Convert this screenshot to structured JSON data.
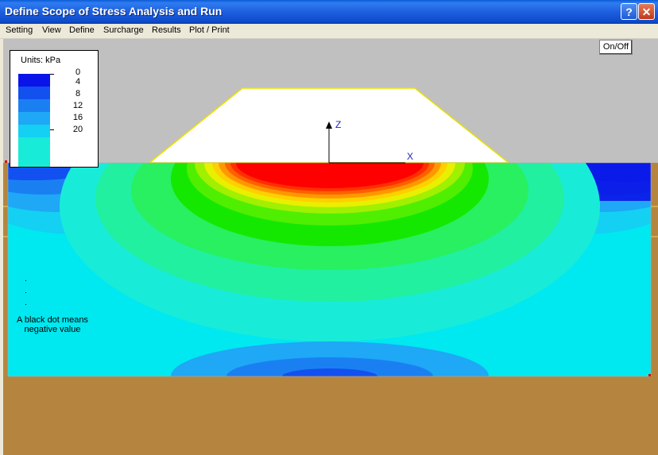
{
  "window": {
    "title": "Define Scope of Stress Analysis and Run",
    "help_glyph": "?",
    "close_glyph": "✕"
  },
  "menu": {
    "items": [
      "Setting",
      "View",
      "Define",
      "Surcharge",
      "Results",
      "Plot / Print"
    ]
  },
  "toolbar": {
    "onoff_label": "On/Off"
  },
  "legend": {
    "title": "Units:  kPa",
    "labels": [
      "0",
      "4",
      "8",
      "12",
      "16",
      "20"
    ],
    "colors": [
      "#0a14e8",
      "#1250f0",
      "#1a80f2",
      "#1ea8f6",
      "#14d0f2",
      "#18ecd8"
    ]
  },
  "axes": {
    "z_label": "Z",
    "x_label": "X"
  },
  "note": {
    "text": "A black dot means negative value"
  },
  "colors": {
    "embankment_fill": "#ffffff",
    "embankment_outline": "#e8e000",
    "ground": "#b5853f",
    "sky": "#c0c0c0",
    "max_stress": "#ff0000"
  },
  "icons": [
    "help-icon",
    "close-icon",
    "z-axis-arrow-icon",
    "x-axis-icon"
  ]
}
